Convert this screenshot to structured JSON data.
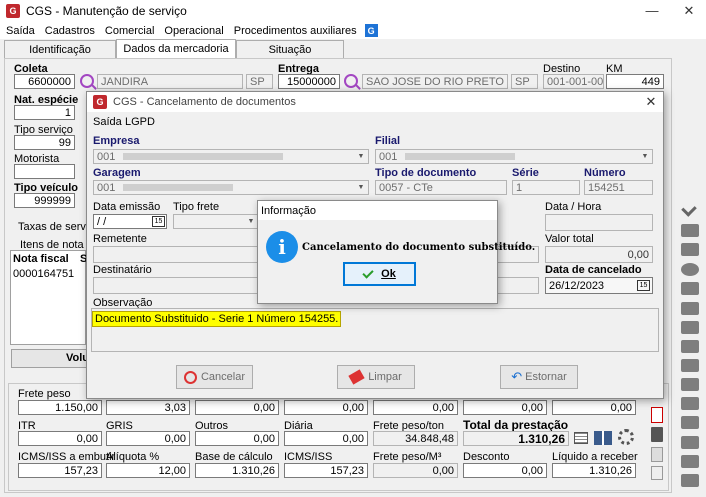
{
  "window": {
    "title": "CGS - Manutenção de serviço",
    "minimize": "—",
    "close": "✕"
  },
  "menu": [
    "Saída",
    "Cadastros",
    "Comercial",
    "Operacional",
    "Procedimentos auxiliares"
  ],
  "help_icon": "G",
  "tabs": [
    "Identificação",
    "Dados da mercadoria",
    "Situação"
  ],
  "coleta": {
    "label": "Coleta",
    "code": "6600000",
    "name": "JANDIRA",
    "uf": "SP"
  },
  "entrega": {
    "label": "Entrega",
    "code": "15000000",
    "name": "SAO JOSE DO RIO PRETO",
    "uf": "SP"
  },
  "destino": {
    "label": "Destino",
    "value": "001-001-001"
  },
  "km": {
    "label": "KM",
    "value": "449"
  },
  "nat_especie": {
    "label": "Nat. espécie",
    "value": "1"
  },
  "tipo_servico": {
    "label": "Tipo serviço",
    "value": "99"
  },
  "motorista": {
    "label": "Motorista"
  },
  "tipo_veiculo": {
    "label": "Tipo veículo",
    "value": "999999"
  },
  "taxas": {
    "label": "Taxas de serviç"
  },
  "itens": {
    "label": "Itens de nota fis",
    "col_nota": "Nota fiscal",
    "col_s": "S",
    "row_nota": "0000164751",
    "volume_label": "Volu"
  },
  "bottom": {
    "frete_peso": {
      "label": "Frete peso",
      "value": "1.150,00"
    },
    "r1c2": "3,03",
    "r1c3": "0,00",
    "r1c4": "0,00",
    "r1c5": "0,00",
    "r1c6": "0,00",
    "r1c7": "0,00",
    "itr": {
      "label": "ITR",
      "value": "0,00"
    },
    "gris": {
      "label": "GRIS",
      "value": "0,00"
    },
    "outros": {
      "label": "Outros",
      "value": "0,00"
    },
    "diaria": {
      "label": "Diária",
      "value": "0,00"
    },
    "frete_ton": {
      "label": "Frete peso/ton",
      "value": "34.848,48"
    },
    "total": {
      "label": "Total da prestação",
      "value": "1.310,26"
    },
    "icms_emb": {
      "label": "ICMS/ISS a embutir",
      "value": "157,23"
    },
    "aliquota": {
      "label": "Alíquota %",
      "value": "12,00"
    },
    "base": {
      "label": "Base de cálculo",
      "value": "1.310,26"
    },
    "icms": {
      "label": "ICMS/ISS",
      "value": "157,23"
    },
    "frete_m3": {
      "label": "Frete peso/M³",
      "value": "0,00"
    },
    "desconto": {
      "label": "Desconto",
      "value": "0,00"
    },
    "liquido": {
      "label": "Líquido a receber",
      "value": "1.310,26"
    }
  },
  "dialog": {
    "title": "CGS - Cancelamento de documentos",
    "menu": [
      "Saída",
      "LGPD"
    ],
    "empresa": {
      "label": "Empresa",
      "value": "001"
    },
    "filial": {
      "label": "Filial",
      "value": "001"
    },
    "garagem": {
      "label": "Garagem",
      "value": "001"
    },
    "tipo_doc": {
      "label": "Tipo de documento",
      "value": "0057 - CTe"
    },
    "serie": {
      "label": "Série",
      "value": "1"
    },
    "numero": {
      "label": "Número",
      "value": "154251"
    },
    "data_emissao": {
      "label": "Data emissão",
      "value": "/ /"
    },
    "tipo_frete": {
      "label": "Tipo frete"
    },
    "data_hora": {
      "label": "Data / Hora"
    },
    "remetente": {
      "label": "Remetente"
    },
    "valor_total": {
      "label": "Valor total",
      "value": "0,00"
    },
    "destinatario": {
      "label": "Destinatário"
    },
    "data_cancel": {
      "label": "Data de cancelado",
      "value": "26/12/2023"
    },
    "observacao": {
      "label": "Observação",
      "value": "Documento Substituido - Serie 1 Número 154255."
    },
    "btn_cancelar": "Cancelar",
    "btn_limpar": "Limpar",
    "btn_estornar": "Estornar",
    "cal_icon": "15"
  },
  "message": {
    "title": "Informação",
    "icon": "i",
    "text": "Cancelamento do documento substituído.",
    "ok": "Ok"
  }
}
